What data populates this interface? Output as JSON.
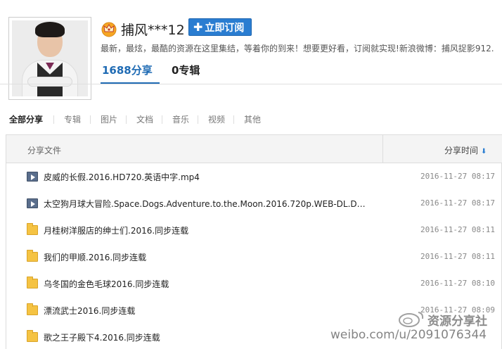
{
  "profile": {
    "username": "捕风***12",
    "subscribe_label": "立即订阅",
    "description": "最新，最炫，最酷的资源在这里集结，等着你的到来！想要更好看，订阅就实现!新浪微博：捕风捉影912.",
    "stats": {
      "share_count": "1688分享",
      "album_count": "0专辑"
    }
  },
  "tabs": [
    {
      "label": "全部分享",
      "active": true
    },
    {
      "label": "专辑",
      "active": false
    },
    {
      "label": "图片",
      "active": false
    },
    {
      "label": "文档",
      "active": false
    },
    {
      "label": "音乐",
      "active": false
    },
    {
      "label": "视频",
      "active": false
    },
    {
      "label": "其他",
      "active": false
    }
  ],
  "table": {
    "header_name": "分享文件",
    "header_time": "分享时间",
    "rows": [
      {
        "type": "video",
        "icon": "video-file-icon",
        "name": "皮威的长假.2016.HD720.英语中字.mp4",
        "time": "2016-11-27 08:17"
      },
      {
        "type": "video",
        "icon": "video-file-icon",
        "name": "太空狗月球大冒险.Space.Dogs.Adventure.to.the.Moon.2016.720p.WEB-DL.D…",
        "time": "2016-11-27 08:17"
      },
      {
        "type": "folder",
        "icon": "folder-icon",
        "name": "月桂树洋服店的绅士们.2016.同步连载",
        "time": "2016-11-27 08:11"
      },
      {
        "type": "folder",
        "icon": "folder-icon",
        "name": "我们的甲顺.2016.同步连载",
        "time": "2016-11-27 08:11"
      },
      {
        "type": "folder",
        "icon": "folder-icon",
        "name": "乌冬国的金色毛球2016.同步连载",
        "time": "2016-11-27 08:10"
      },
      {
        "type": "folder",
        "icon": "folder-icon",
        "name": "漂流武士2016.同步连载",
        "time": "2016-11-27 08:09"
      },
      {
        "type": "folder",
        "icon": "folder-icon",
        "name": "歌之王子殿下4.2016.同步连载",
        "time": ""
      }
    ]
  },
  "watermark": {
    "url": "weibo.com/u/2091076344",
    "brand": "资源分享社"
  },
  "colors": {
    "accent": "#2a7dd1",
    "link": "#1f6bb4",
    "folder": "#f5c343"
  }
}
